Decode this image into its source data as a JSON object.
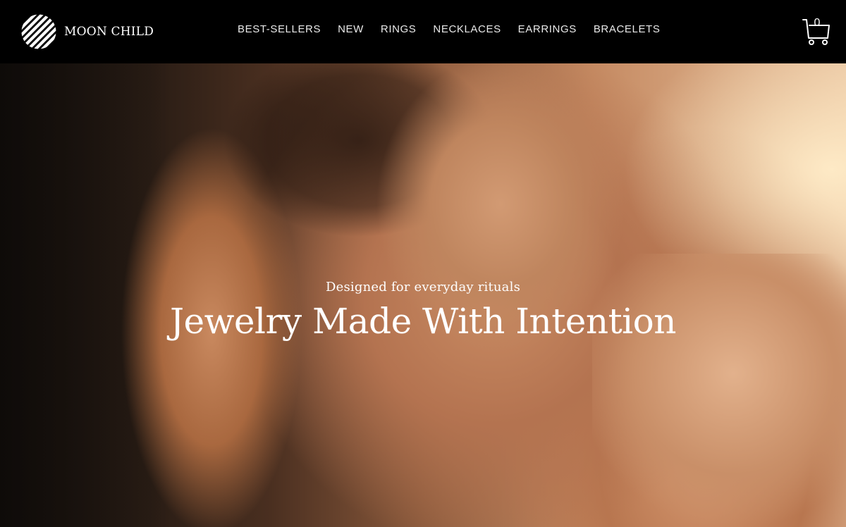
{
  "brand": {
    "name": "MOON CHILD",
    "logo_icon": "striped-circle-logo",
    "colors": {
      "header_bg": "#000000",
      "text": "#ffffff",
      "nav_text": "#e9e9e9"
    }
  },
  "nav": {
    "items": [
      {
        "label": "BEST-SELLERS"
      },
      {
        "label": "NEW"
      },
      {
        "label": "RINGS"
      },
      {
        "label": "NECKLACES"
      },
      {
        "label": "EARRINGS"
      },
      {
        "label": "BRACELETS"
      }
    ]
  },
  "cart": {
    "icon": "cart-icon",
    "count": "0"
  },
  "hero": {
    "subtitle": "Designed for everyday rituals",
    "title": "Jewelry Made With Intention"
  }
}
